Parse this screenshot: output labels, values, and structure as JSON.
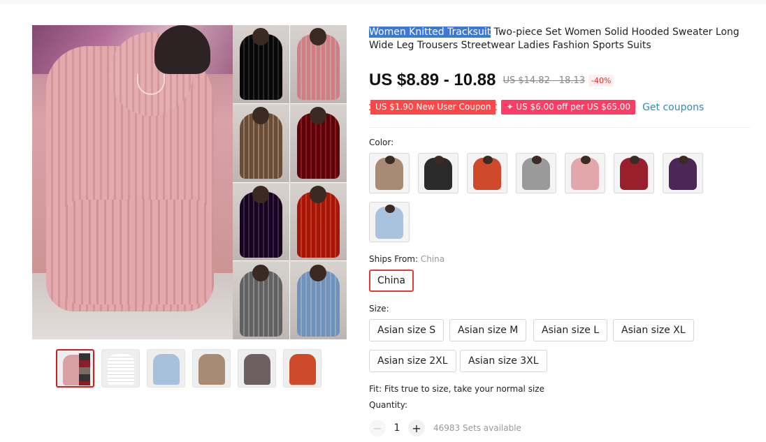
{
  "product": {
    "title_highlight": "Women Knitted Tracksuit",
    "title_rest": " Two-piece Set Women Solid Hooded Sweater Long Wide Leg Trousers Streetwear Ladies Fashion Sports Suits",
    "price": "US $8.89 - 10.88",
    "old_price": "US $14.82 - 18.13",
    "discount": "-40%"
  },
  "coupons": {
    "new_user": "US $1.90 New User Coupon",
    "store": "✦ US $6.00 off per US $65.00",
    "get_label": "Get coupons"
  },
  "color": {
    "label": "Color:",
    "options": [
      {
        "name": "khaki",
        "hex": "#a88b72"
      },
      {
        "name": "black",
        "hex": "#2b2b2b"
      },
      {
        "name": "orange-red",
        "hex": "#cf4a2a"
      },
      {
        "name": "gray",
        "hex": "#9a9a9a"
      },
      {
        "name": "pink",
        "hex": "#e3a6aa"
      },
      {
        "name": "wine-red",
        "hex": "#9a1f2c"
      },
      {
        "name": "purple",
        "hex": "#4b2656"
      },
      {
        "name": "light-blue",
        "hex": "#a9c2de"
      }
    ]
  },
  "ships_from": {
    "label": "Ships From: ",
    "value": "China",
    "options": [
      "China"
    ]
  },
  "size": {
    "label": "Size:",
    "options": [
      "Asian size S",
      "Asian size M",
      "Asian size L",
      "Asian size XL",
      "Asian size 2XL",
      "Asian size 3XL"
    ]
  },
  "fit": "Fit: Fits true to size, take your normal size",
  "quantity": {
    "label": "Quantity:",
    "value": "1",
    "minus": "−",
    "plus": "+",
    "available": "46983 Sets available"
  },
  "gallery": {
    "grid_colors": [
      "#2e2e2e",
      "#e7b3b6",
      "#a78b74",
      "#9b1e2b",
      "#4a2557",
      "#d0482a",
      "#9d9d9d",
      "#a8c0dc"
    ],
    "thumb_colors": [
      "#d9a0a4",
      "#f0f0f0",
      "#a8c0dc",
      "#a88b72",
      "#6d6060",
      "#cf4a2a"
    ]
  }
}
